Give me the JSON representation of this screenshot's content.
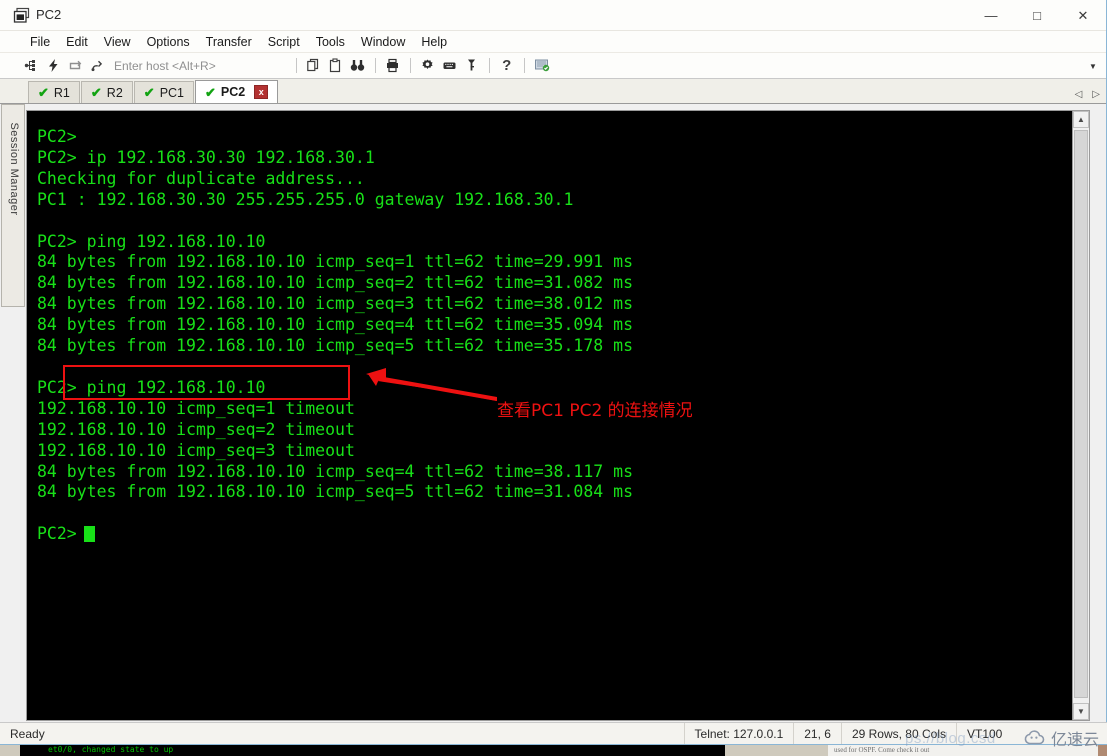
{
  "window": {
    "title": "PC2",
    "icon": "terminal-window-icon",
    "controls": {
      "minimize": "—",
      "maximize": "□",
      "close": "✕"
    }
  },
  "menubar": {
    "items": [
      "File",
      "Edit",
      "View",
      "Options",
      "Transfer",
      "Script",
      "Tools",
      "Window",
      "Help"
    ]
  },
  "toolbar": {
    "host_placeholder": "Enter host <Alt+R>",
    "icons": [
      "connect-icon",
      "quick-connect-icon",
      "reconnect-icon",
      "connect-sftp-icon",
      "copy-icon",
      "paste-icon",
      "find-icon",
      "print-icon",
      "settings-icon",
      "keymap-icon",
      "key-icon",
      "help-icon",
      "session-options-icon"
    ],
    "overflow": "▼"
  },
  "tabs": {
    "items": [
      {
        "label": "R1",
        "status": "connected",
        "active": false
      },
      {
        "label": "R2",
        "status": "connected",
        "active": false
      },
      {
        "label": "PC1",
        "status": "connected",
        "active": false
      },
      {
        "label": "PC2",
        "status": "connected",
        "active": true
      }
    ],
    "close_label": "x",
    "nav_prev": "◁",
    "nav_next": "▷"
  },
  "sidebar": {
    "label": "Session Manager"
  },
  "terminal": {
    "lines": [
      "PC2>",
      "PC2> ip 192.168.30.30 192.168.30.1",
      "Checking for duplicate address...",
      "PC1 : 192.168.30.30 255.255.255.0 gateway 192.168.30.1",
      "",
      "PC2> ping 192.168.10.10",
      "84 bytes from 192.168.10.10 icmp_seq=1 ttl=62 time=29.991 ms",
      "84 bytes from 192.168.10.10 icmp_seq=2 ttl=62 time=31.082 ms",
      "84 bytes from 192.168.10.10 icmp_seq=3 ttl=62 time=38.012 ms",
      "84 bytes from 192.168.10.10 icmp_seq=4 ttl=62 time=35.094 ms",
      "84 bytes from 192.168.10.10 icmp_seq=5 ttl=62 time=35.178 ms",
      "",
      "PC2> ping 192.168.10.10",
      "192.168.10.10 icmp_seq=1 timeout",
      "192.168.10.10 icmp_seq=2 timeout",
      "192.168.10.10 icmp_seq=3 timeout",
      "84 bytes from 192.168.10.10 icmp_seq=4 ttl=62 time=38.117 ms",
      "84 bytes from 192.168.10.10 icmp_seq=5 ttl=62 time=31.084 ms",
      ""
    ],
    "prompt": "PC2>",
    "foreground": "#18e018",
    "background": "#000000"
  },
  "annotation": {
    "text": "查看PC1 PC2 的连接情况",
    "color": "#ee1111"
  },
  "statusbar": {
    "ready": "Ready",
    "protocol": "Telnet: 127.0.0.1",
    "cursor_pos": "21,  6",
    "dimensions": "29 Rows, 80 Cols",
    "emulation": "VT100"
  },
  "watermark": {
    "url": "ps://blog.csd",
    "brand": "亿速云"
  },
  "background_windows": {
    "terminal_line": "et0/0, changed state to up",
    "document_line": "used for OSPF. Come check it out"
  }
}
